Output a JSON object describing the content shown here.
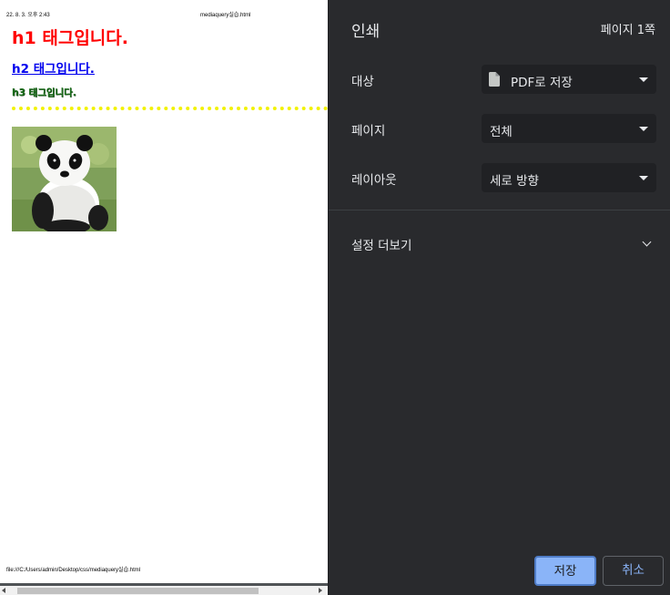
{
  "preview": {
    "header_date": "22. 8. 3. 오후 2:43",
    "header_title": "mediaquery실습.html",
    "h1": "h1 태그입니다.",
    "h2": "h2 태그입니다.",
    "h3": "h3 태그입니다.",
    "image_icon": "panda-photo",
    "footer_url": "file:///C:/Users/admin/Desktop/css/mediaquery실습.html"
  },
  "panel": {
    "title": "인쇄",
    "page_count": "페이지 1쪽",
    "destination": {
      "label": "대상",
      "value": "PDF로 저장",
      "icon": "file-icon"
    },
    "pages": {
      "label": "페이지",
      "value": "전체"
    },
    "layout": {
      "label": "레이아웃",
      "value": "세로 방향"
    },
    "more_settings": "설정 더보기",
    "save_button": "저장",
    "cancel_button": "취소"
  },
  "colors": {
    "panel_bg": "#292a2d",
    "select_bg": "#202124",
    "accent": "#8ab4f8",
    "h1_color": "#ff0000",
    "h2_color": "#0000ee",
    "h3_color": "#1a6e1a",
    "divider_color": "#f2f200"
  }
}
